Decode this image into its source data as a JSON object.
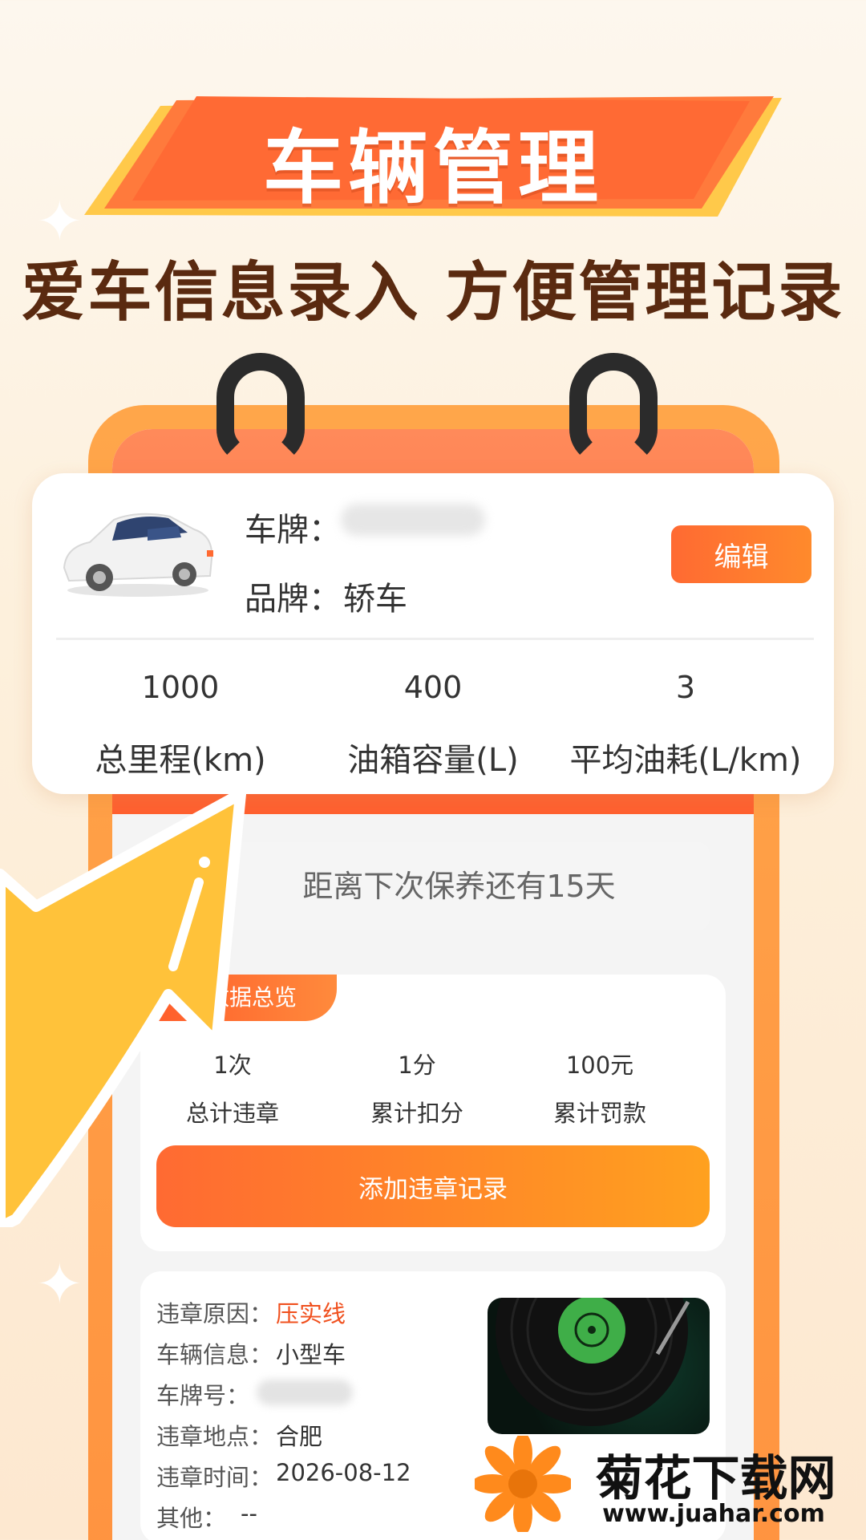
{
  "banner": {
    "title": "车辆管理",
    "subtitle": "爱车信息录入 方便管理记录"
  },
  "car": {
    "plate_label": "车牌：",
    "brand_label": "品牌：",
    "brand_value": "轿车",
    "edit_label": "编辑",
    "stats": [
      {
        "value": "1000",
        "label": "总里程(km)"
      },
      {
        "value": "400",
        "label": "油箱容量(L)"
      },
      {
        "value": "3",
        "label": "平均油耗(L/km)"
      }
    ]
  },
  "maintenance": {
    "text": "距离下次保养还有15天"
  },
  "violations": {
    "tag": "章数据总览",
    "stats": [
      {
        "value": "1次",
        "label": "总计违章"
      },
      {
        "value": "1分",
        "label": "累计扣分"
      },
      {
        "value": "100元",
        "label": "累计罚款"
      }
    ],
    "add_label": "添加违章记录"
  },
  "detail": {
    "reason_label": "违章原因：",
    "reason_value": "压实线",
    "vehicle_label": "车辆信息：",
    "vehicle_value": "小型车",
    "plate_label": "车牌号：",
    "place_label": "违章地点：",
    "place_value": "合肥",
    "time_label": "违章时间：",
    "time_value": "2026-08-12",
    "other_label": "其他：",
    "other_value": "--"
  },
  "watermark": {
    "title": "菊花下载网",
    "url": "www.juahar.com"
  },
  "colors": {
    "accent": "#ff6a32",
    "brand_brown": "#5a2a10",
    "arrow": "#ffc23a"
  }
}
